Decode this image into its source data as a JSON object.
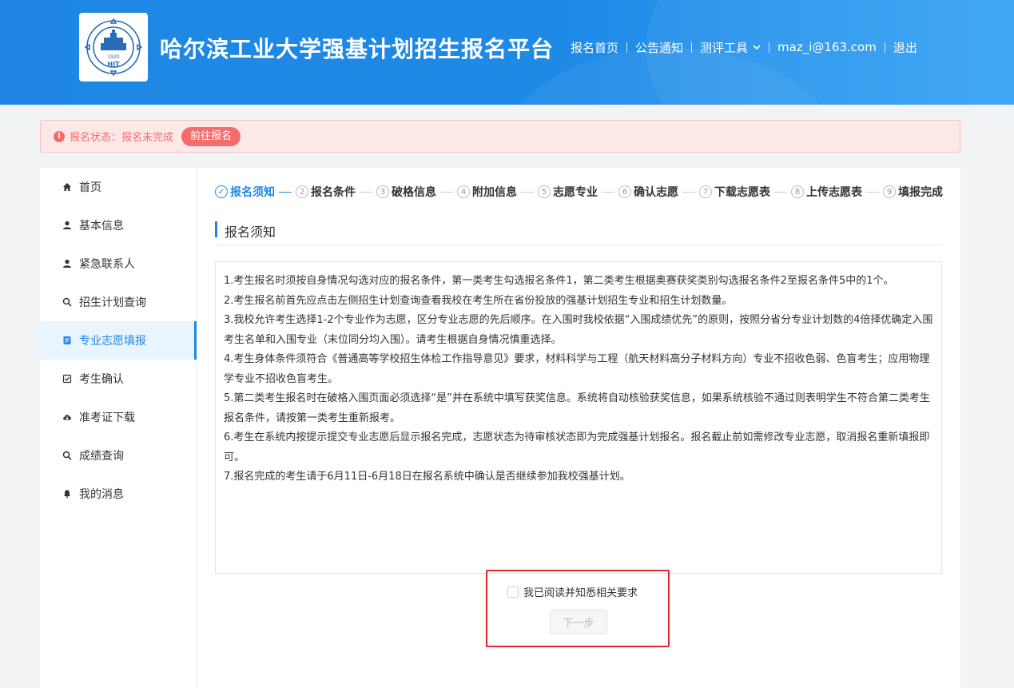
{
  "header": {
    "logo_text": "HIT",
    "logo_year": "1920",
    "title": "哈尔滨工业大学强基计划招生报名平台",
    "nav": [
      {
        "label": "报名首页"
      },
      {
        "label": "公告通知"
      },
      {
        "label": "测评工具"
      },
      {
        "label": "maz_i@163.com"
      },
      {
        "label": "退出"
      }
    ]
  },
  "alert": {
    "status": "报名状态：报名未完成",
    "button": "前往报名",
    "color": "#f56c6c"
  },
  "sidebar": {
    "items": [
      {
        "label": "首页",
        "icon": "home-icon"
      },
      {
        "label": "基本信息",
        "icon": "user-icon"
      },
      {
        "label": "紧急联系人",
        "icon": "user-icon"
      },
      {
        "label": "招生计划查询",
        "icon": "search-icon"
      },
      {
        "label": "专业志愿填报",
        "icon": "form-icon",
        "active": true
      },
      {
        "label": "考生确认",
        "icon": "check-square-icon"
      },
      {
        "label": "准考证下载",
        "icon": "cloud-download-icon"
      },
      {
        "label": "成绩查询",
        "icon": "search-icon"
      },
      {
        "label": "我的消息",
        "icon": "bell-icon"
      }
    ]
  },
  "steps": [
    {
      "num": "✓",
      "label": "报名须知",
      "active": true
    },
    {
      "num": "2",
      "label": "报名条件"
    },
    {
      "num": "3",
      "label": "破格信息"
    },
    {
      "num": "4",
      "label": "附加信息"
    },
    {
      "num": "5",
      "label": "志愿专业"
    },
    {
      "num": "6",
      "label": "确认志愿"
    },
    {
      "num": "7",
      "label": "下载志愿表"
    },
    {
      "num": "8",
      "label": "上传志愿表"
    },
    {
      "num": "9",
      "label": "填报完成"
    }
  ],
  "section_title": "报名须知",
  "notice": [
    "1.考生报名时须按自身情况勾选对应的报名条件，第一类考生勾选报名条件1，第二类考生根据奥赛获奖类别勾选报名条件2至报名条件5中的1个。",
    "2.考生报名前首先应点击左侧招生计划查询查看我校在考生所在省份投放的强基计划招生专业和招生计划数量。",
    "3.我校允许考生选择1-2个专业作为志愿，区分专业志愿的先后顺序。在入围时我校依据“入围成绩优先”的原则，按照分省分专业计划数的4倍择优确定入围考生名单和入围专业（末位同分均入围）。请考生根据自身情况慎重选择。",
    "4.考生身体条件须符合《普通高等学校招生体检工作指导意见》要求，材料科学与工程（航天材料高分子材料方向）专业不招收色弱、色盲考生；应用物理学专业不招收色盲考生。",
    "5.第二类考生报名时在破格入围页面必须选择“是”并在系统中填写获奖信息。系统将自动核验获奖信息，如果系统核验不通过则表明学生不符合第二类考生报名条件，请按第一类考生重新报考。",
    "6.考生在系统内按提示提交专业志愿后显示报名完成，志愿状态为待审核状态即为完成强基计划报名。报名截止前如需修改专业志愿，取消报名重新填报即可。",
    "7.报名完成的考生请于6月11日-6月18日在报名系统中确认是否继续参加我校强基计划。"
  ],
  "agree": {
    "label": "我已阅读并知悉相关要求",
    "next_button": "下一步"
  },
  "colors": {
    "primary": "#1e88e5",
    "highlight": "#e0282e"
  }
}
